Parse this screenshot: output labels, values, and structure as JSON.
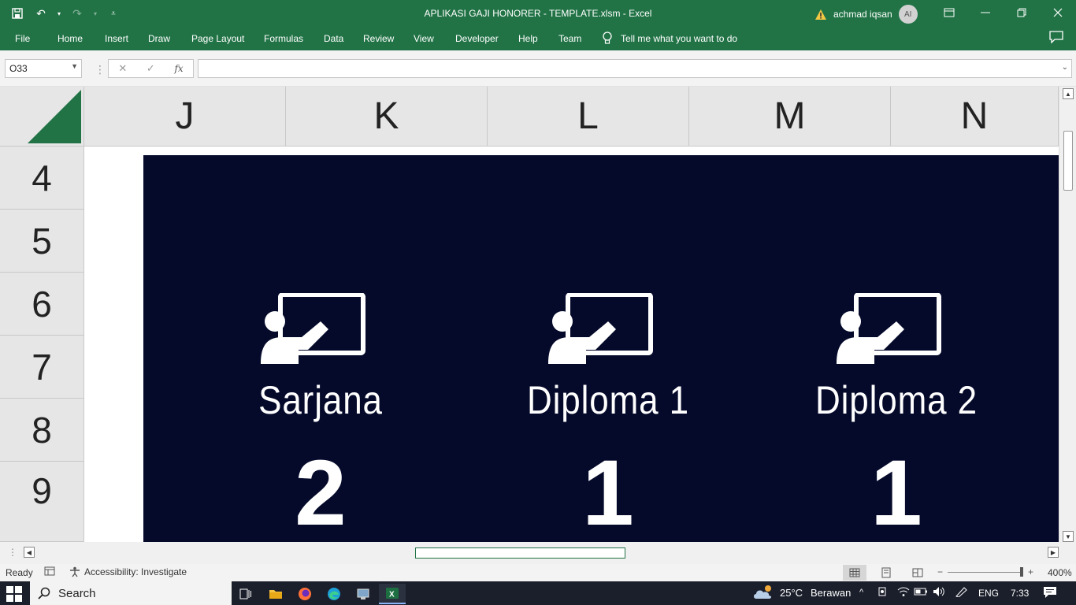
{
  "window": {
    "title": "APLIKASI GAJI HONORER - TEMPLATE.xlsm  -  Excel",
    "user_name": "achmad iqsan",
    "user_initials": "AI"
  },
  "ribbon": {
    "tabs": [
      "File",
      "Home",
      "Insert",
      "Draw",
      "Page Layout",
      "Formulas",
      "Data",
      "Review",
      "View",
      "Developer",
      "Help",
      "Team"
    ],
    "tell_me": "Tell me what you want to do"
  },
  "formula_bar": {
    "name_box": "O33",
    "formula": "",
    "fx_label": "fx"
  },
  "columns": [
    "J",
    "K",
    "L",
    "M",
    "N"
  ],
  "rows": [
    "4",
    "5",
    "6",
    "7",
    "8",
    "9"
  ],
  "dashboard": {
    "cards": [
      {
        "label": "Sarjana",
        "value": "2"
      },
      {
        "label": "Diploma 1",
        "value": "1"
      },
      {
        "label": "Diploma 2",
        "value": "1"
      }
    ]
  },
  "status_bar": {
    "ready": "Ready",
    "accessibility": "Accessibility: Investigate",
    "zoom": "400%"
  },
  "taskbar": {
    "search_placeholder": "Search",
    "weather_temp": "25°C",
    "weather_desc": "Berawan",
    "language": "ENG",
    "time": "7:33"
  },
  "colors": {
    "excel_green": "#217346",
    "dashboard_bg": "#050a2a"
  }
}
